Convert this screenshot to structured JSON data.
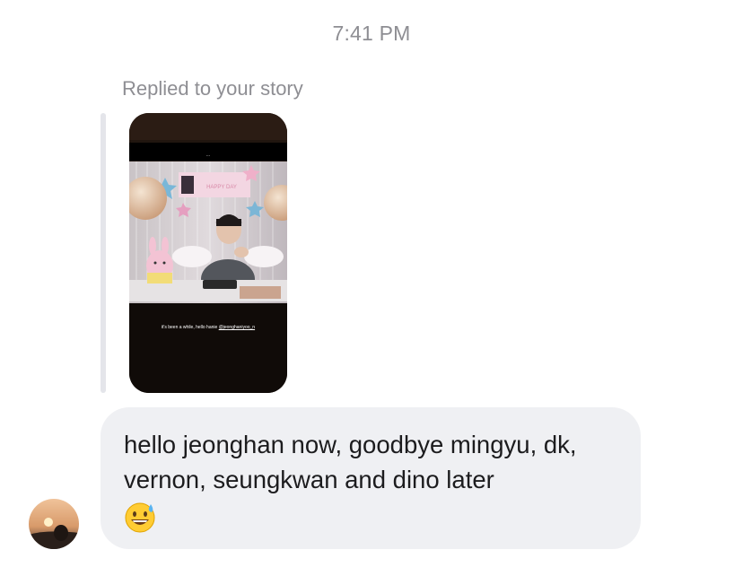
{
  "thread": {
    "timestamp": "7:41 PM",
    "reply_context": "Replied to your story",
    "story": {
      "caption_text": "it's been a while, hello hanie ",
      "caption_mention": "@jeonghaniyoo_n"
    },
    "message": {
      "text": "hello jeonghan now, goodbye mingyu, dk, vernon, seungkwan and dino later",
      "emoji": "grinning-sweat-emoji"
    },
    "sender": {
      "avatar": "sunset-avatar"
    }
  },
  "colors": {
    "bubble": "#eff0f3",
    "meta_text": "#8e8e93",
    "message_text": "#1c1c1e",
    "reply_bar": "#e4e5ea"
  }
}
